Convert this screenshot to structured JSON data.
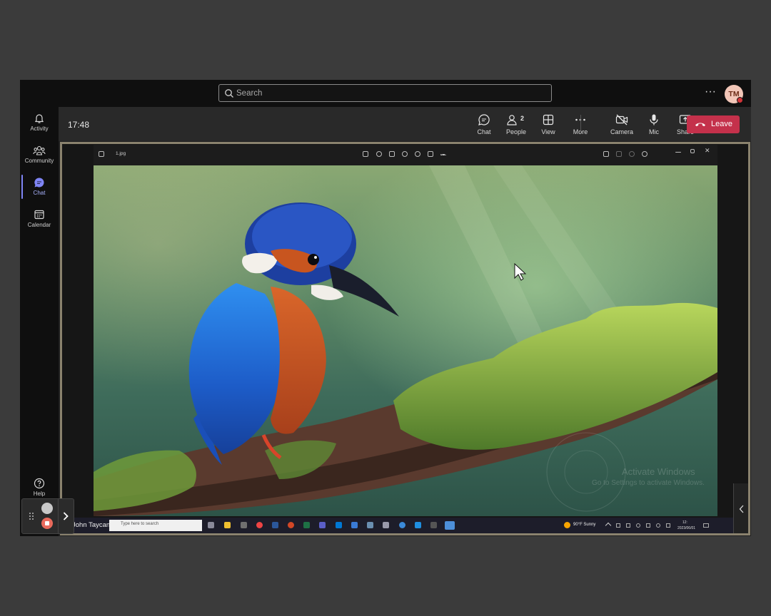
{
  "search": {
    "placeholder": "Search"
  },
  "header": {
    "more": "···",
    "avatar_initials": "TM"
  },
  "rail": {
    "items": [
      {
        "label": "Activity",
        "icon": "bell-icon"
      },
      {
        "label": "Community",
        "icon": "community-icon"
      },
      {
        "label": "Chat",
        "icon": "chat-icon",
        "active": true
      },
      {
        "label": "Calendar",
        "icon": "calendar-icon"
      }
    ],
    "help": "Help"
  },
  "meeting": {
    "time": "17:48",
    "controls": {
      "chat": "Chat",
      "people": "People",
      "people_count": "2",
      "view": "View",
      "more": "More",
      "camera": "Camera",
      "mic": "Mic",
      "share": "Share"
    },
    "leave": "Leave"
  },
  "shared_screen": {
    "filename": "1.jpg",
    "presenter": "John Taycan",
    "taskbar_search": "Type here to search",
    "weather": "90°F  Sunny",
    "clock_time": "12:",
    "clock_date": "2023/06/01",
    "watermark_title": "Activate Windows",
    "watermark_sub": "Go to Settings to activate Windows."
  },
  "colors": {
    "leave": "#c4314b",
    "accent": "#7f85f5",
    "stage_border": "#8a826e"
  }
}
